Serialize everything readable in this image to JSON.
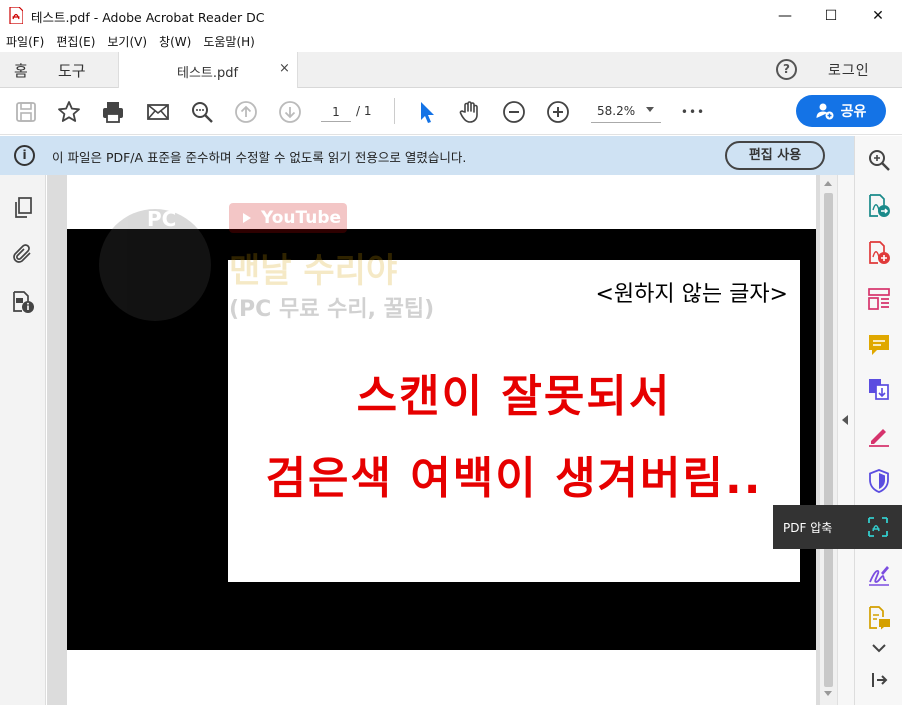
{
  "window": {
    "title": "테스트.pdf - Adobe Acrobat Reader DC",
    "minimize": "—",
    "maximize": "☐",
    "close": "✕"
  },
  "menu": [
    {
      "label": "파일(F)"
    },
    {
      "label": "편집(E)"
    },
    {
      "label": "보기(V)"
    },
    {
      "label": "창(W)"
    },
    {
      "label": "도움말(H)"
    }
  ],
  "tabs": {
    "home": "홈",
    "tools": "도구",
    "doc_tab": "테스트.pdf",
    "doc_close": "×",
    "help": "?",
    "login": "로그인"
  },
  "toolbar": {
    "page_current": "1",
    "page_total": "/ 1",
    "zoom": "58.2%",
    "more": "•••",
    "share": "공유"
  },
  "infobar": {
    "icon": "i",
    "message": "이 파일은 PDF/A 표준을 준수하며 수정할 수 없도록 읽기 전용으로 열렸습니다.",
    "edit_button": "편집 사용"
  },
  "document": {
    "note": "<원하지 않는 글자>",
    "line1": "스캔이 잘못되서",
    "line2": "검은색 여백이 생겨버림..",
    "watermark": {
      "pc": "PC",
      "youtube": "YouTube",
      "title": "맨날 수리야",
      "subtitle": "(PC 무료 수리, 꿀팁)"
    }
  },
  "tooltip": {
    "label": "PDF 압축"
  },
  "colors": {
    "accent": "#1473e6",
    "infobar_bg": "#cfe2f3",
    "red_text": "#e60000"
  }
}
